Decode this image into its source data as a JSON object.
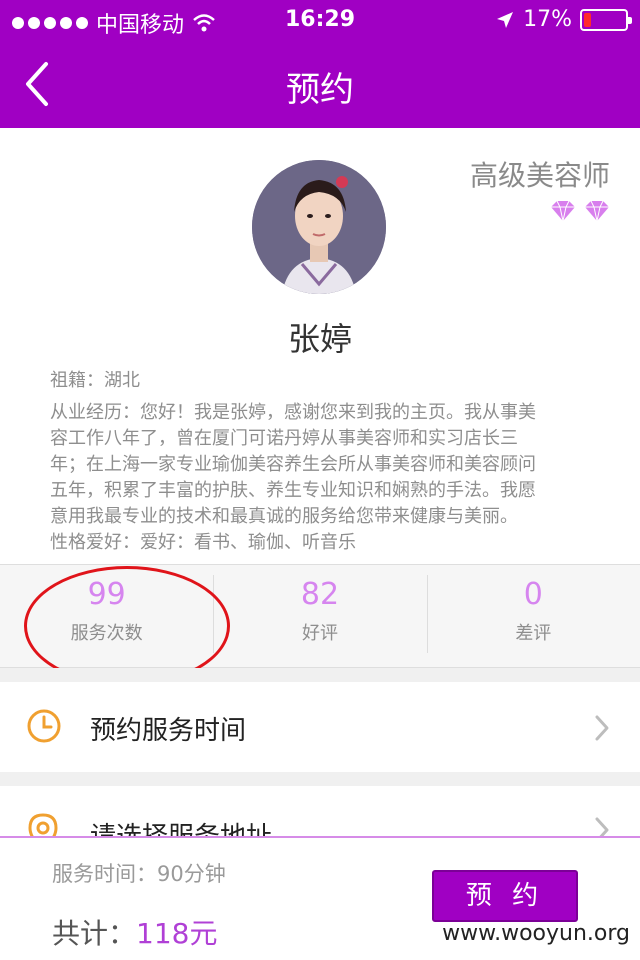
{
  "status_bar": {
    "carrier": "中国移动",
    "time": "16:29",
    "battery": "17%",
    "battery_level": 0.17
  },
  "nav": {
    "title": "预约"
  },
  "profile": {
    "level": "高级美容师",
    "gem_count": 2,
    "name": "张婷",
    "native_place": "祖籍：湖北",
    "experience_lines": [
      "从业经历：您好！我是张婷，感谢您来到我的主页。我从事美",
      "容工作八年了，曾在厦门可诺丹婷从事美容师和实习店长三",
      "年；在上海一家专业瑜伽美容养生会所从事美容师和美容顾问",
      "五年，积累了丰富的护肤、养生专业知识和娴熟的手法。我愿",
      "意用我最专业的技术和最真诚的服务给您带来健康与美丽。"
    ],
    "hobbies": "性格爱好：爱好：看书、瑜伽、听音乐"
  },
  "stats": [
    {
      "value": "99",
      "label": "服务次数"
    },
    {
      "value": "82",
      "label": "好评"
    },
    {
      "value": "0",
      "label": "差评"
    }
  ],
  "rows": {
    "time_label": "预约服务时间",
    "address_label": "请选择服务地址"
  },
  "footer": {
    "duration": "服务时间：90分钟",
    "total_label": "共计：",
    "total_price": "118元",
    "button": "预 约"
  },
  "watermark": "www.wooyun.org",
  "colors": {
    "brand": "#a000c3",
    "accent": "#d685ef",
    "annotation": "#e0141a"
  }
}
